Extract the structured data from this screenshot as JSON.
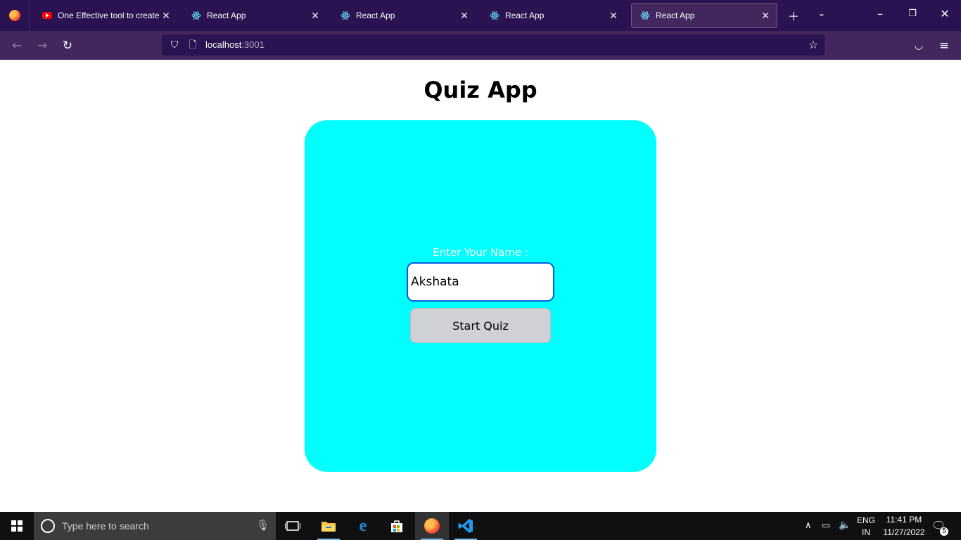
{
  "browser": {
    "tabs": [
      {
        "label": "One Effective tool to create R",
        "icon": "youtube-icon"
      },
      {
        "label": "React App",
        "icon": "react-icon"
      },
      {
        "label": "React App",
        "icon": "react-icon"
      },
      {
        "label": "React App",
        "icon": "react-icon"
      },
      {
        "label": "React App",
        "icon": "react-icon"
      }
    ],
    "url_host": "localhost",
    "url_port": ":3001"
  },
  "page": {
    "title": "Quiz App",
    "name_label": "Enter Your Name :",
    "name_value": "Akshata",
    "start_button": "Start Quiz",
    "card_color": "#00ffff"
  },
  "taskbar": {
    "search_placeholder": "Type here to search",
    "lang_top": "ENG",
    "lang_bottom": "IN",
    "time": "11:41 PM",
    "date": "11/27/2022",
    "notification_count": "5"
  }
}
